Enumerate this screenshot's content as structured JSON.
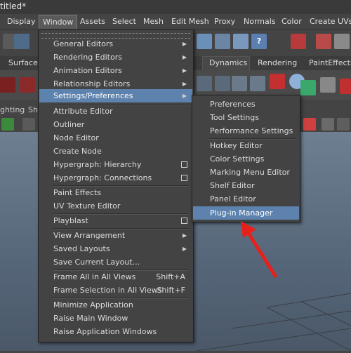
{
  "window": {
    "title": "titled*"
  },
  "menubar": {
    "items": [
      "Display",
      "Window",
      "Assets",
      "Select",
      "Mesh",
      "Edit Mesh",
      "Proxy",
      "Normals",
      "Color",
      "Create UVs"
    ]
  },
  "shelf_tabs": [
    "Surfaces",
    "Dynamics",
    "Rendering",
    "PaintEffects"
  ],
  "panel_menus": [
    "ghting",
    "Sho"
  ],
  "window_menu": {
    "items": [
      {
        "label": "General Editors",
        "arrow": true
      },
      {
        "label": "Rendering Editors",
        "arrow": true
      },
      {
        "label": "Animation Editors",
        "arrow": true
      },
      {
        "label": "Relationship Editors",
        "arrow": true
      },
      {
        "label": "Settings/Preferences",
        "arrow": true
      },
      {
        "label": "Attribute Editor"
      },
      {
        "label": "Outliner"
      },
      {
        "label": "Node Editor"
      },
      {
        "label": "Create Node"
      },
      {
        "label": "Hypergraph: Hierarchy",
        "option": true
      },
      {
        "label": "Hypergraph: Connections",
        "option": true
      },
      {
        "label": "Paint Effects"
      },
      {
        "label": "UV Texture Editor"
      },
      {
        "label": "Playblast",
        "option": true
      },
      {
        "label": "View Arrangement",
        "arrow": true
      },
      {
        "label": "Saved Layouts",
        "arrow": true
      },
      {
        "label": "Save Current Layout..."
      },
      {
        "label": "Frame All in All Views",
        "hotkey": "Shift+A"
      },
      {
        "label": "Frame Selection in All Views",
        "hotkey": "Shift+F"
      },
      {
        "label": "Minimize Application"
      },
      {
        "label": "Raise Main Window"
      },
      {
        "label": "Raise Application Windows"
      }
    ]
  },
  "settings_submenu": {
    "items": [
      {
        "label": "Preferences"
      },
      {
        "label": "Tool Settings"
      },
      {
        "label": "Performance Settings"
      },
      {
        "label": "Hotkey Editor"
      },
      {
        "label": "Color Settings"
      },
      {
        "label": "Marking Menu Editor"
      },
      {
        "label": "Shelf Editor"
      },
      {
        "label": "Panel Editor"
      },
      {
        "label": "Plug-in Manager"
      }
    ]
  },
  "colors": {
    "highlight": "#5d82ad",
    "annotation_arrow": "#e8201c"
  }
}
